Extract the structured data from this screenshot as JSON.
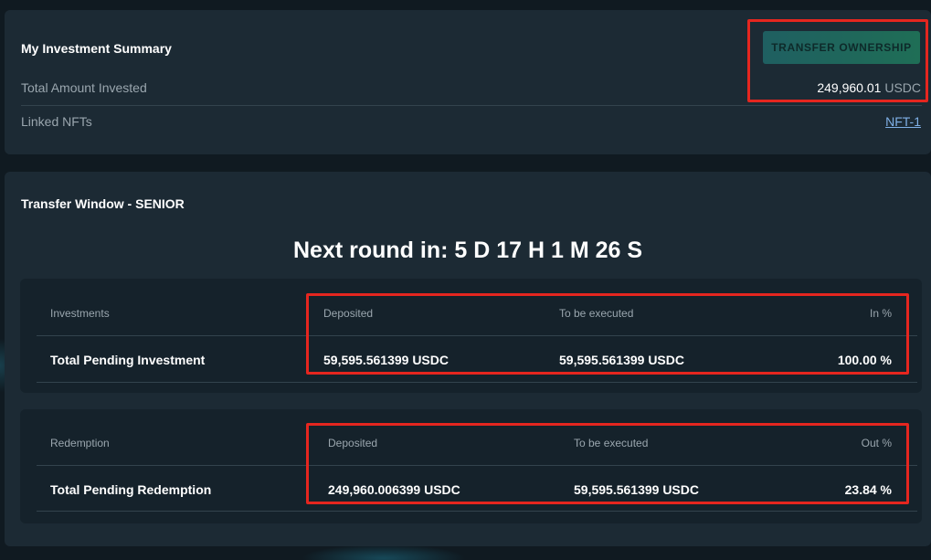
{
  "summary": {
    "title": "My Investment Summary",
    "transfer_button_label": "TRANSFER OWNERSHIP",
    "total_invested_label": "Total Amount Invested",
    "total_invested_value": "249,960.01",
    "total_invested_unit": "USDC",
    "linked_nfts_label": "Linked NFTs",
    "linked_nft": "NFT-1"
  },
  "transfer_window": {
    "title": "Transfer Window - SENIOR",
    "countdown": "Next round in: 5 D 17 H 1 M 26 S",
    "investments": {
      "headers": [
        "Investments",
        "Deposited",
        "To be executed",
        "In %"
      ],
      "row_label": "Total Pending Investment",
      "deposited": "59,595.561399 USDC",
      "to_be_executed": "59,595.561399 USDC",
      "percent": "100.00 %"
    },
    "redemption": {
      "headers": [
        "Redemption",
        "Deposited",
        "To be executed",
        "Out %"
      ],
      "row_label": "Total Pending Redemption",
      "deposited": "249,960.006399 USDC",
      "to_be_executed": "59,595.561399 USDC",
      "percent": "23.84 %"
    }
  },
  "colors": {
    "background": "#101a21",
    "card": "#1c2a34",
    "highlight": "#e5261f",
    "button": "#1f6e56",
    "link": "#7fb0e6"
  }
}
